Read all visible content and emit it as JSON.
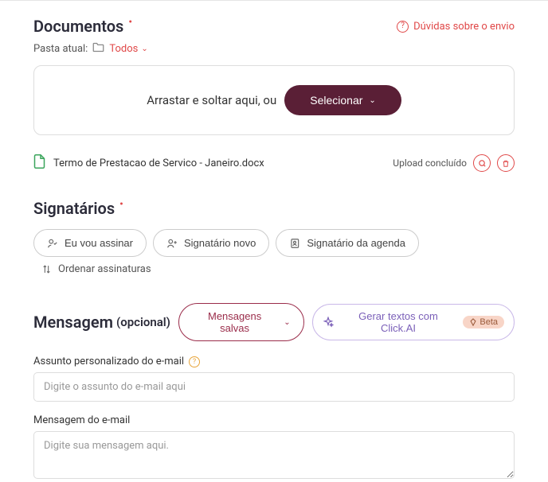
{
  "documents": {
    "title": "Documentos",
    "help_link": "Dúvidas sobre o envio",
    "folder_label": "Pasta atual:",
    "folder_name": "Todos",
    "dropzone_text": "Arrastar e soltar aqui, ou",
    "select_btn": "Selecionar",
    "file": {
      "name": "Termo de Prestacao de Servico - Janeiro.docx",
      "status": "Upload concluído"
    }
  },
  "signers": {
    "title": "Signatários",
    "btn_me": "Eu vou assinar",
    "btn_new": "Signatário novo",
    "btn_agenda": "Signatário da agenda",
    "order_link": "Ordenar assinaturas"
  },
  "message": {
    "title": "Mensagem",
    "optional": "(opcional)",
    "saved_btn": "Mensagens salvas",
    "ai_btn": "Gerar textos com Click.AI",
    "beta_label": "Beta",
    "subject_label": "Assunto personalizado do e-mail",
    "subject_placeholder": "Digite o assunto do e-mail aqui",
    "body_label": "Mensagem do e-mail",
    "body_placeholder": "Digite sua mensagem aqui."
  }
}
